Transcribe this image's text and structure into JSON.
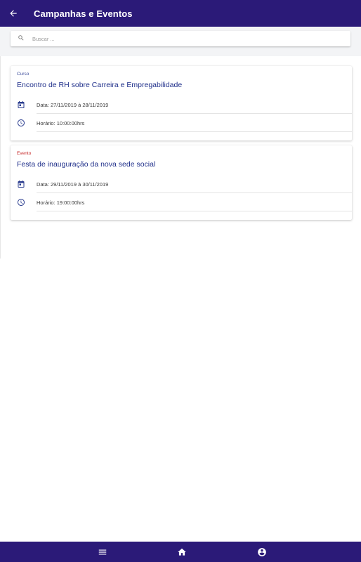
{
  "header": {
    "title": "Campanhas e Eventos",
    "back_icon": "arrow-back-icon"
  },
  "search": {
    "placeholder": "Buscar ...",
    "value": ""
  },
  "colors": {
    "primary": "#2b1a78",
    "title_blue": "#1f2f8a",
    "type_curso": "#3c4c9a",
    "type_evento": "#c62828",
    "background": "#f3f4f6"
  },
  "events": [
    {
      "type": "Curso",
      "title": "Encontro de RH sobre Carreira e Empregabilidade",
      "date_label": "Data: 27/11/2019 à 28/11/2019",
      "time_label": "Horário: 10:00:00hrs"
    },
    {
      "type": "Evento",
      "title": "Festa de inauguração da nova sede social",
      "date_label": "Data: 29/11/2019 à 30/11/2019",
      "time_label": "Horário: 19:00:00hrs"
    }
  ],
  "bottom_nav": {
    "items": [
      "menu-icon",
      "home-icon",
      "account-icon"
    ]
  }
}
